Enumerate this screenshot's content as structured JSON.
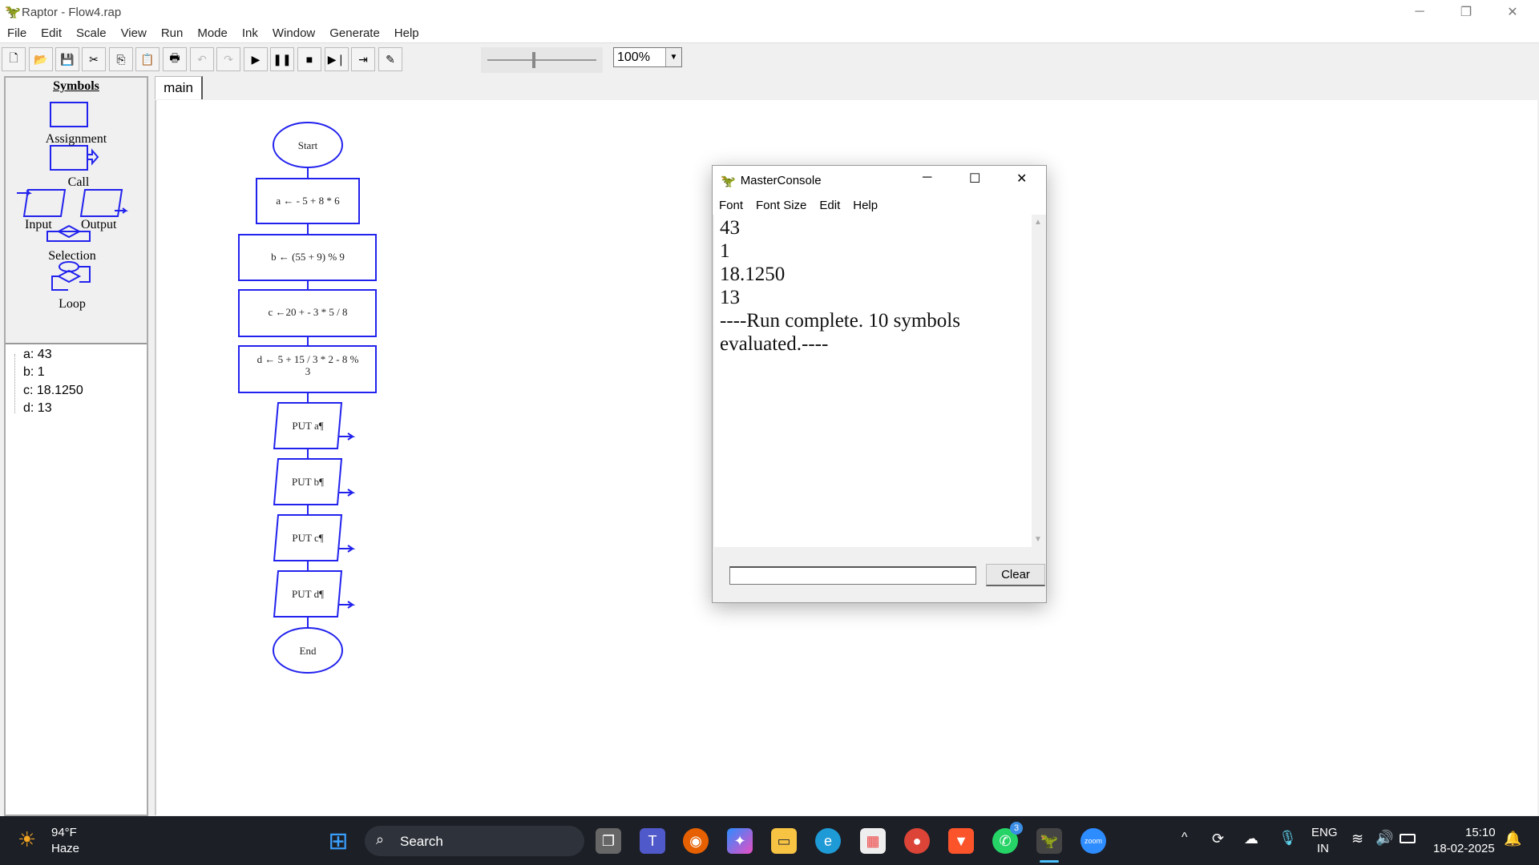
{
  "window": {
    "title": "Raptor - Flow4.rap",
    "minimize": "─",
    "restore": "❐",
    "close": "✕"
  },
  "menu": [
    "File",
    "Edit",
    "Scale",
    "View",
    "Run",
    "Mode",
    "Ink",
    "Window",
    "Generate",
    "Help"
  ],
  "toolbar": {
    "buttons": [
      {
        "icon": "new-icon",
        "g": "🗋"
      },
      {
        "icon": "open-icon",
        "g": "📂"
      },
      {
        "icon": "save-icon",
        "g": "💾"
      },
      {
        "icon": "cut-icon",
        "g": "✂"
      },
      {
        "icon": "copy-icon",
        "g": "⎘"
      },
      {
        "icon": "paste-icon",
        "g": "📋"
      },
      {
        "icon": "print-icon",
        "g": "🖶"
      },
      {
        "icon": "undo-icon",
        "g": "↶"
      },
      {
        "icon": "redo-icon",
        "g": "↷"
      },
      {
        "icon": "run-icon",
        "g": "▶"
      },
      {
        "icon": "pause-icon",
        "g": "❚❚"
      },
      {
        "icon": "stop-icon",
        "g": "■"
      },
      {
        "icon": "step-icon",
        "g": "▶❘"
      },
      {
        "icon": "step-into-icon",
        "g": "⇥"
      },
      {
        "icon": "pen-icon",
        "g": "✎"
      }
    ],
    "zoom": "100%"
  },
  "symbols": {
    "title": "Symbols",
    "items": [
      "Assignment",
      "Call",
      "Input",
      "Output",
      "Selection",
      "Loop"
    ]
  },
  "variables": [
    "a: 43",
    "b: 1",
    "c: 18.1250",
    "d: 13"
  ],
  "tab": "main",
  "flowchart": {
    "start": "Start",
    "end": "End",
    "assignments": [
      "a ←  - 5 + 8 * 6",
      "b ← (55 + 9) % 9",
      "c ←20 +  - 3 * 5 / 8",
      "d ← 5 + 15 / 3 * 2 - 8 %",
      "3"
    ],
    "outputs": [
      "PUT a¶",
      "PUT b¶",
      "PUT c¶",
      "PUT d¶"
    ]
  },
  "console": {
    "title": "MasterConsole",
    "menu": [
      "Font",
      "Font Size",
      "Edit",
      "Help"
    ],
    "lines": [
      "43",
      "1",
      "18.1250",
      "13",
      "----Run complete.  10 symbols",
      "evaluated.----"
    ],
    "input": "",
    "clear": "Clear"
  },
  "taskbar": {
    "weather_temp": "94°F",
    "weather_desc": "Haze",
    "search": "Search",
    "lang1": "ENG",
    "lang2": "IN",
    "time": "15:10",
    "date": "18-02-2025",
    "whatsapp_badge": "3",
    "zoom_label": "zoom"
  }
}
